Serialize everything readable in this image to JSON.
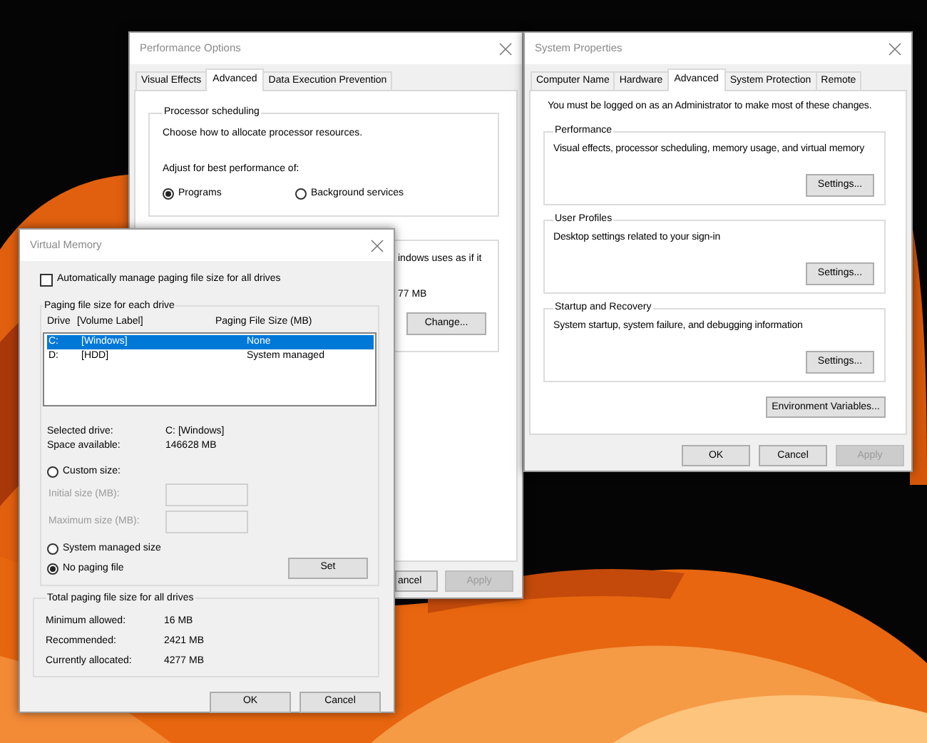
{
  "performance_options": {
    "title": "Performance Options",
    "tabs": [
      {
        "label": "Visual Effects",
        "selected": false
      },
      {
        "label": "Advanced",
        "selected": true
      },
      {
        "label": "Data Execution Prevention",
        "selected": false
      }
    ],
    "processor_scheduling": {
      "title": "Processor scheduling",
      "description": "Choose how to allocate processor resources.",
      "prompt": "Adjust for best performance of:",
      "options": [
        {
          "label": "Programs",
          "selected": true
        },
        {
          "label": "Background services",
          "selected": false
        }
      ]
    },
    "virtual_memory_group": {
      "text_1": "indows uses as if it",
      "text_2": "77 MB",
      "button": "Change..."
    },
    "buttons": [
      {
        "label": "ancel",
        "disabled": false
      },
      {
        "label": "Apply",
        "disabled": true
      }
    ]
  },
  "system_properties": {
    "title": "System Properties",
    "tabs": [
      {
        "label": "Computer Name",
        "selected": false
      },
      {
        "label": "Hardware",
        "selected": false
      },
      {
        "label": "Advanced",
        "selected": true
      },
      {
        "label": "System Protection",
        "selected": false
      },
      {
        "label": "Remote",
        "selected": false
      }
    ],
    "notice": "You must be logged on as an Administrator to make most of these changes.",
    "groups": [
      {
        "title": "Performance",
        "description": "Visual effects, processor scheduling, memory usage, and virtual memory",
        "button": "Settings..."
      },
      {
        "title": "User Profiles",
        "description": "Desktop settings related to your sign-in",
        "button": "Settings..."
      },
      {
        "title": "Startup and Recovery",
        "description": "System startup, system failure, and debugging information",
        "button": "Settings..."
      }
    ],
    "environment_button": "Environment Variables...",
    "buttons": [
      {
        "label": "OK",
        "disabled": false
      },
      {
        "label": "Cancel",
        "disabled": false
      },
      {
        "label": "Apply",
        "disabled": true
      }
    ]
  },
  "virtual_memory": {
    "title": "Virtual Memory",
    "auto_manage": {
      "label": "Automatically manage paging file size for all drives",
      "checked": false
    },
    "drives_group": {
      "title": "Paging file size for each drive",
      "columns": [
        "Drive",
        "[Volume Label]",
        "Paging File Size (MB)"
      ],
      "rows": [
        {
          "drive": "C:",
          "volume_label": "[Windows]",
          "size": "None",
          "selected": true
        },
        {
          "drive": "D:",
          "volume_label": "[HDD]",
          "size": "System managed",
          "selected": false
        }
      ],
      "info": [
        {
          "label": "Selected drive:",
          "value": "C:  [Windows]"
        },
        {
          "label": "Space available:",
          "value": "146628 MB"
        }
      ],
      "size_options": [
        {
          "label": "Custom size:",
          "selected": false
        },
        {
          "label": "System managed size",
          "selected": false
        },
        {
          "label": "No paging file",
          "selected": true
        }
      ],
      "size_fields": [
        {
          "label": "Initial size (MB):",
          "disabled": true
        },
        {
          "label": "Maximum size (MB):",
          "disabled": true
        }
      ],
      "set_button": "Set"
    },
    "totals": {
      "title": "Total paging file size for all drives",
      "rows": [
        {
          "label": "Minimum allowed:",
          "value": "16 MB"
        },
        {
          "label": "Recommended:",
          "value": "2421 MB"
        },
        {
          "label": "Currently allocated:",
          "value": "4277 MB"
        }
      ]
    },
    "buttons": [
      {
        "label": "OK",
        "disabled": false
      },
      {
        "label": "Cancel",
        "disabled": false
      }
    ]
  }
}
